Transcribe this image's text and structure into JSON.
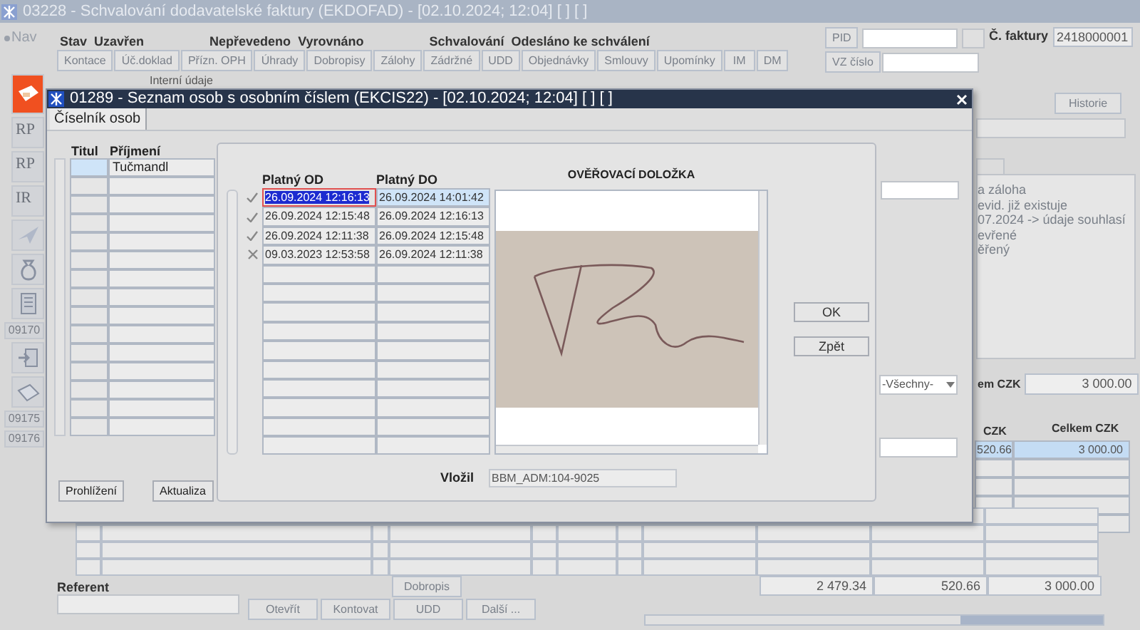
{
  "main_window": {
    "title": "03228 - Schvalování dodavatelské faktury (EKDOFAD) - [02.10.2024; 12:04] [ ] [ ]",
    "nav": "Nav",
    "sidebar": [
      {
        "kind": "icon",
        "selected": true
      },
      {
        "kind": "text",
        "text": "RP",
        "selected": false
      },
      {
        "kind": "text",
        "text": "RP",
        "selected": false
      },
      {
        "kind": "text",
        "text": "IR",
        "selected": false
      },
      {
        "kind": "icon",
        "selected": false
      },
      {
        "kind": "icon",
        "selected": false
      },
      {
        "kind": "icon",
        "selected": false
      },
      {
        "kind": "code",
        "text": "09170",
        "selected": false
      },
      {
        "kind": "icon",
        "selected": false
      },
      {
        "kind": "icon",
        "selected": false
      },
      {
        "kind": "code",
        "text": "09175",
        "selected": false
      },
      {
        "kind": "code",
        "text": "09176",
        "selected": false
      }
    ],
    "status": [
      {
        "label": "Stav",
        "value": "Uzavřen"
      },
      {
        "label": "Nepřevedeno",
        "value": "Vyrovnáno"
      },
      {
        "label": "Schvalování",
        "value": "Odesláno ke schválení"
      }
    ],
    "toolbar_buttons": [
      "Kontace",
      "Úč.doklad",
      "Přízn. OPH",
      "Úhrady",
      "Dobropisy",
      "Zálohy",
      "Zádržné",
      "UDD",
      "Objednávky",
      "Smlouvy",
      "Upomínky",
      "IM",
      "DM"
    ],
    "pid": {
      "label": "PID"
    },
    "vz": {
      "label": "VZ číslo"
    },
    "invoice": {
      "label": "Č. faktury",
      "value": "2418000001"
    },
    "section_label": "Interní údaje",
    "history_button": "Historie",
    "notes": [
      "a záloha",
      "evid. již existuje",
      "07.2024 -> údaje souhlasí",
      "evřené",
      "ěřený"
    ],
    "total": {
      "label": "em CZK",
      "value": "3 000.00"
    },
    "grid_headers": [
      "CZK",
      "Celkem CZK"
    ],
    "grid_first_row": [
      "520.66",
      "3 000.00"
    ],
    "referent": {
      "label": "Referent"
    },
    "dobropis_button": "Dobropis",
    "bottom_buttons": [
      "Otevřít",
      "Kontovat",
      "UDD",
      "Další ..."
    ],
    "totals": [
      "2 479.34",
      "520.66",
      "3 000.00"
    ]
  },
  "persons_window": {
    "title": "01289 - Seznam osob s osobním číslem (EKCIS22) - [02.10.2024; 12:04] [ ] [ ]",
    "tabs": [
      {
        "label": "Číselník osob",
        "selected": true
      }
    ],
    "columns": [
      "Titul",
      "Příjmení"
    ],
    "rows": [
      {
        "surname": "Tučmandl",
        "selected": true
      }
    ],
    "buttons": [
      "Prohlížení",
      "Aktualiza"
    ],
    "filter": "-Všechny-"
  },
  "validity_dialog": {
    "columns": [
      "Platný OD",
      "Platný DO"
    ],
    "rows": [
      {
        "kind": "valid",
        "from": "26.09.2024 12:16:13",
        "to": "26.09.2024 14:01:42",
        "selected": true
      },
      {
        "kind": "valid",
        "from": "26.09.2024 12:15:48",
        "to": "26.09.2024 12:16:13",
        "selected": false
      },
      {
        "kind": "valid",
        "from": "26.09.2024 12:11:38",
        "to": "26.09.2024 12:15:48",
        "selected": false
      },
      {
        "kind": "invalid",
        "from": "09.03.2023 12:53:58",
        "to": "26.09.2024 12:11:38",
        "selected": false
      }
    ],
    "title": "OVĚŘOVACÍ DOLOŽKA",
    "inserted_by": {
      "label": "Vložil",
      "value": "BBM_ADM:104-9025"
    },
    "buttons": [
      "OK",
      "Zpět"
    ]
  }
}
